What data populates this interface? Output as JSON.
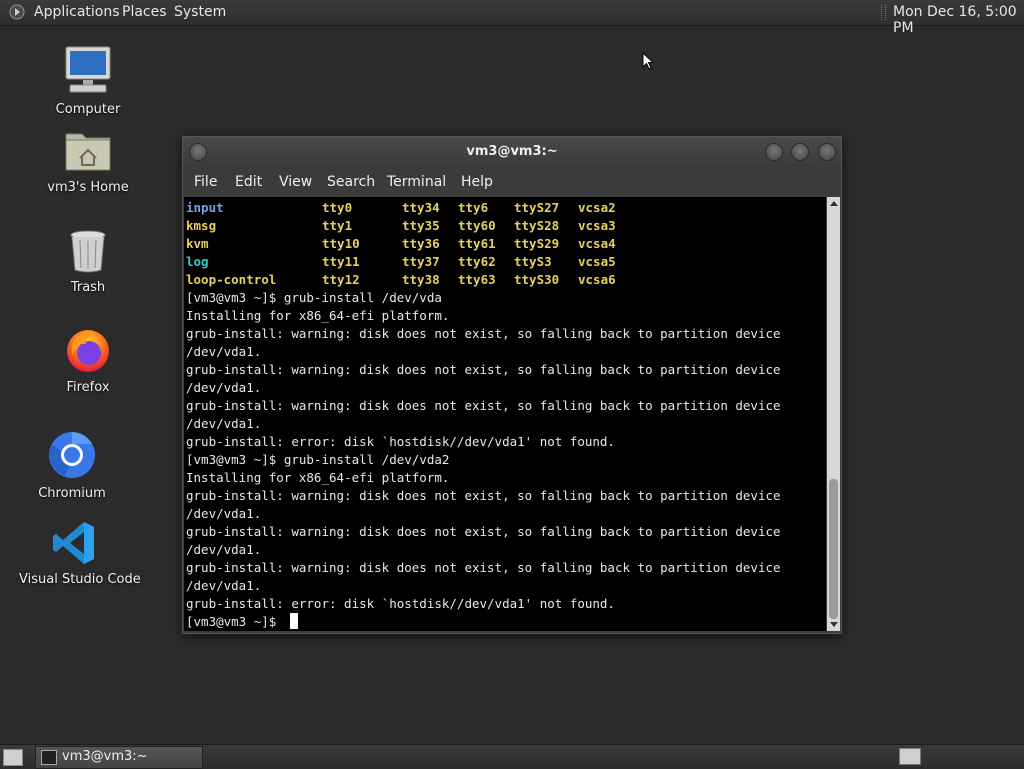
{
  "top_panel": {
    "menus": [
      "Applications",
      "Places",
      "System"
    ],
    "clock": "Mon Dec 16,  5:00 PM"
  },
  "desktop_icons": [
    {
      "label": "Computer",
      "icon": "computer-icon"
    },
    {
      "label": "vm3's Home",
      "icon": "home-folder-icon"
    },
    {
      "label": "Trash",
      "icon": "trash-icon"
    },
    {
      "label": "Firefox",
      "icon": "firefox-icon"
    },
    {
      "label": "Chromium",
      "icon": "chromium-icon"
    },
    {
      "label": "Visual Studio Code",
      "icon": "vscode-icon"
    }
  ],
  "terminal": {
    "title": "vm3@vm3:~",
    "menus": [
      "File",
      "Edit",
      "View",
      "Search",
      "Terminal",
      "Help"
    ],
    "listing": [
      [
        "input",
        "tty0",
        "tty34",
        "tty6",
        "ttyS27",
        "vcsa2"
      ],
      [
        "kmsg",
        "tty1",
        "tty35",
        "tty60",
        "ttyS28",
        "vcsa3"
      ],
      [
        "kvm",
        "tty10",
        "tty36",
        "tty61",
        "ttyS29",
        "vcsa4"
      ],
      [
        "log",
        "tty11",
        "tty37",
        "tty62",
        "ttyS3",
        "vcsa5"
      ],
      [
        "loop-control",
        "tty12",
        "tty38",
        "tty63",
        "ttyS30",
        "vcsa6"
      ]
    ],
    "lines": [
      "[vm3@vm3 ~]$ grub-install /dev/vda",
      "Installing for x86_64-efi platform.",
      "grub-install: warning: disk does not exist, so falling back to partition device",
      "/dev/vda1.",
      "grub-install: warning: disk does not exist, so falling back to partition device",
      "/dev/vda1.",
      "grub-install: warning: disk does not exist, so falling back to partition device",
      "/dev/vda1.",
      "grub-install: error: disk `hostdisk//dev/vda1' not found.",
      "[vm3@vm3 ~]$ grub-install /dev/vda2",
      "Installing for x86_64-efi platform.",
      "grub-install: warning: disk does not exist, so falling back to partition device",
      "/dev/vda1.",
      "grub-install: warning: disk does not exist, so falling back to partition device",
      "/dev/vda1.",
      "grub-install: warning: disk does not exist, so falling back to partition device",
      "/dev/vda1.",
      "grub-install: error: disk `hostdisk//dev/vda1' not found.",
      "[vm3@vm3 ~]$ "
    ]
  },
  "taskbar": {
    "task_label": "vm3@vm3:~"
  }
}
